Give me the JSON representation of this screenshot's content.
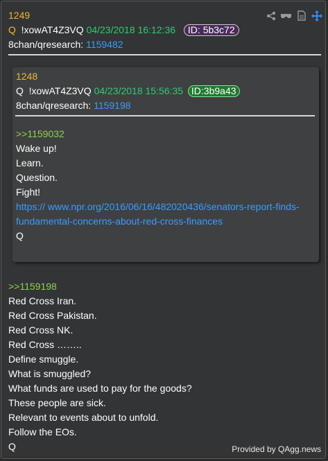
{
  "post": {
    "number": "1249",
    "q_mark": "Q",
    "author": "!xowAT4Z3VQ",
    "datetime": "04/23/2018 16:12:36",
    "id_badge": "ID: 5b3c72",
    "board": "8chan/qresearch:",
    "post_ref": "1159482"
  },
  "quoted": {
    "number": "1248",
    "q_mark": "Q",
    "author": "!xowAT4Z3VQ",
    "datetime": "04/23/2018 15:56:35",
    "id_badge": "ID:3b9a43",
    "board": "8chan/qresearch:",
    "post_ref": "1159198",
    "reply_link": ">>1159032",
    "lines": [
      "Wake up!",
      "Learn.",
      "Question.",
      "Fight!"
    ],
    "url_line1": "https:// www.npr.org/2016/06/16/482020436/senators-report-finds-",
    "url_line2": "fundamental-concerns-about-red-cross-finances",
    "signoff": "Q"
  },
  "body": {
    "reply_link": ">>1159198",
    "lines": [
      "Red Cross Iran.",
      "Red Cross Pakistan.",
      "Red Cross NK.",
      "Red Cross ……..",
      "Define smuggle.",
      "What is smuggled?",
      "What funds are used to pay for the goods?",
      "These people are sick.",
      "Relevant to events about to unfold.",
      "Follow the EOs.",
      "Q"
    ]
  },
  "footer": "Provided by QAgg.news",
  "icons": [
    "share-icon",
    "glasses-icon",
    "document-icon",
    "move-icon"
  ]
}
